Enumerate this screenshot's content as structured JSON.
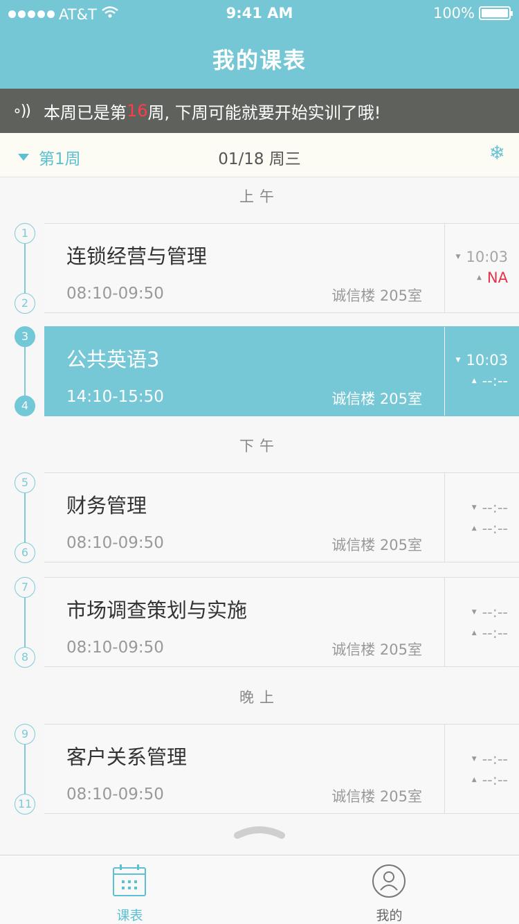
{
  "status_bar": {
    "carrier": "AT&T",
    "time": "9:41 AM",
    "battery": "100%"
  },
  "header": {
    "title": "我的课表"
  },
  "notice": {
    "prefix": "本周已是第",
    "week": "16",
    "suffix": "周, 下周可能就要开始实训了哦!"
  },
  "week_bar": {
    "week_label": "第1周",
    "date": "01/18 周三"
  },
  "sections": {
    "morning": "上午",
    "afternoon": "下午",
    "evening": "晚上"
  },
  "courses": [
    {
      "start": "1",
      "end": "2",
      "name": "连锁经营与管理",
      "time": "08:10-09:50",
      "room": "诚信楼 205室",
      "in": "10:03",
      "out": "NA"
    },
    {
      "start": "3",
      "end": "4",
      "name": "公共英语3",
      "time": "14:10-15:50",
      "room": "诚信楼 205室",
      "in": "10:03",
      "out": "--:--"
    },
    {
      "start": "5",
      "end": "6",
      "name": "财务管理",
      "time": "08:10-09:50",
      "room": "诚信楼 205室",
      "in": "--:--",
      "out": "--:--"
    },
    {
      "start": "7",
      "end": "8",
      "name": "市场调查策划与实施",
      "time": "08:10-09:50",
      "room": "诚信楼 205室",
      "in": "--:--",
      "out": "--:--"
    },
    {
      "start": "9",
      "end": "11",
      "name": "客户关系管理",
      "time": "08:10-09:50",
      "room": "诚信楼 205室",
      "in": "--:--",
      "out": "--:--"
    }
  ],
  "tabbar": {
    "schedule": "课表",
    "mine": "我的"
  },
  "colors": {
    "accent": "#76c7d6",
    "notice_bg": "#5f625c",
    "alert": "#e33448"
  },
  "icons": [
    "speaker-icon",
    "dropdown-triangle-icon",
    "snowflake-icon",
    "calendar-icon",
    "user-icon"
  ]
}
